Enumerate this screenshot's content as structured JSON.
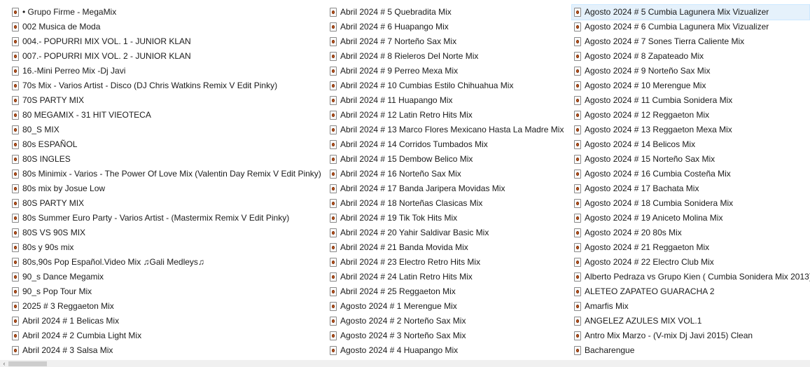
{
  "files": {
    "col0": [
      "• Grupo Firme - MegaMix",
      "002 Musica de Moda",
      "004.- POPURRI MIX VOL. 1 - JUNIOR KLAN",
      "007.- POPURRI MIX VOL. 2 - JUNIOR KLAN",
      "16.-Mini Perreo Mix -Dj Javi",
      "70s Mix - Varios Artist - Disco (DJ Chris Watkins Remix V Edit Pinky)",
      "70S PARTY MIX",
      "80 MEGAMIX - 31 HIT VIEOTECA",
      "80_S MIX",
      "80s ESPAÑOL",
      "80S INGLES",
      "80s Minimix - Varios - The Power Of Love Mix (Valentin Day Remix V Edit Pinky)",
      "80s mix by Josue Low",
      "80S PARTY MIX",
      "80s Summer Euro Party - Varios Artist  - (Mastermix Remix V Edit Pinky)",
      "80S VS 90S MIX",
      "80s y 90s mix",
      "80s,90s Pop Español.Video Mix ♫Gali Medleys♫",
      "90_s Dance Megamix",
      "90_s Pop Tour Mix",
      "2025  # 3   Reggaeton Mix",
      "Abril 2024 # 1 Belicas Mix",
      "Abril 2024 # 2 Cumbia Light Mix",
      "Abril 2024 # 3 Salsa Mix"
    ],
    "col1": [
      "Abril 2024 # 5 Quebradita Mix",
      "Abril 2024 # 6 Huapango Mix",
      "Abril 2024 # 7 Norteño Sax Mix",
      "Abril 2024 # 8 Rieleros Del Norte Mix",
      "Abril 2024 # 9 Perreo Mexa Mix",
      "Abril 2024 # 10 Cumbias Estilo Chihuahua Mix",
      "Abril 2024 # 11 Huapango Mix",
      "Abril 2024 # 12 Latin Retro Hits Mix",
      "Abril 2024 # 13 Marco Flores Mexicano Hasta La Madre Mix",
      "Abril 2024 # 14 Corridos Tumbados Mix",
      "Abril 2024 # 15 Dembow Belico Mix",
      "Abril 2024 # 16 Norteño Sax Mix",
      "Abril 2024 # 17 Banda Jaripera Movidas Mix",
      "Abril 2024 # 18 Norteñas Clasicas Mix",
      "Abril 2024 # 19 Tik Tok Hits Mix",
      "Abril 2024 # 20 Yahir Saldivar Basic Mix",
      "Abril 2024 # 21 Banda Movida Mix",
      "Abril 2024 # 23 Electro Retro Hits Mix",
      "Abril 2024 # 24 Latin Retro Hits Mix",
      "Abril 2024 # 25 Reggaeton Mix",
      "Agosto 2024 # 1 Merengue Mix",
      "Agosto 2024 # 2 Norteño Sax Mix",
      "Agosto 2024 # 3 Norteño Sax Mix",
      "Agosto 2024 # 4 Huapango Mix"
    ],
    "col2": [
      "Agosto 2024 # 5 Cumbia Lagunera Mix Vizualizer",
      "Agosto 2024 # 6 Cumbia Lagunera Mix Vizualizer",
      "Agosto 2024 # 7 Sones Tierra Caliente Mix",
      "Agosto 2024 # 8 Zapateado Mix",
      "Agosto 2024 # 9 Norteño Sax Mix",
      "Agosto 2024 # 10 Merengue Mix",
      "Agosto 2024 # 11 Cumbia Sonidera Mix",
      "Agosto 2024 # 12 Reggaeton Mix",
      "Agosto 2024 # 13 Reggaeton Mexa Mix",
      "Agosto 2024 # 14 Belicos Mix",
      "Agosto 2024 # 15 Norteño Sax Mix",
      "Agosto 2024 # 16 Cumbia Costeña Mix",
      "Agosto 2024 # 17 Bachata Mix",
      "Agosto 2024 # 18 Cumbia Sonidera Mix",
      "Agosto 2024 # 19 Aniceto Molina Mix",
      "Agosto 2024 # 20 80s Mix",
      "Agosto 2024 # 21 Reggaeton Mix",
      "Agosto 2024 # 22 Electro Club Mix",
      "Alberto Pedraza vs Grupo Kien ( Cumbia Sonidera Mix 2013)",
      "ALETEO ZAPATEO GUARACHA 2",
      "Amarfis Mix",
      "ANGELEZ AZULES MIX VOL.1",
      "Antro Mix Marzo - (V-mix Dj Javi 2015) Clean",
      "Bacharengue"
    ]
  },
  "selected": {
    "column": 2,
    "index": 0
  },
  "icons": {
    "file": "media-file-icon",
    "scroll_left": "chevron-left-icon"
  },
  "colors": {
    "selection_bg": "#e5f1fb",
    "selection_border": "#cce8ff",
    "icon_accent": "#c35a1f"
  }
}
